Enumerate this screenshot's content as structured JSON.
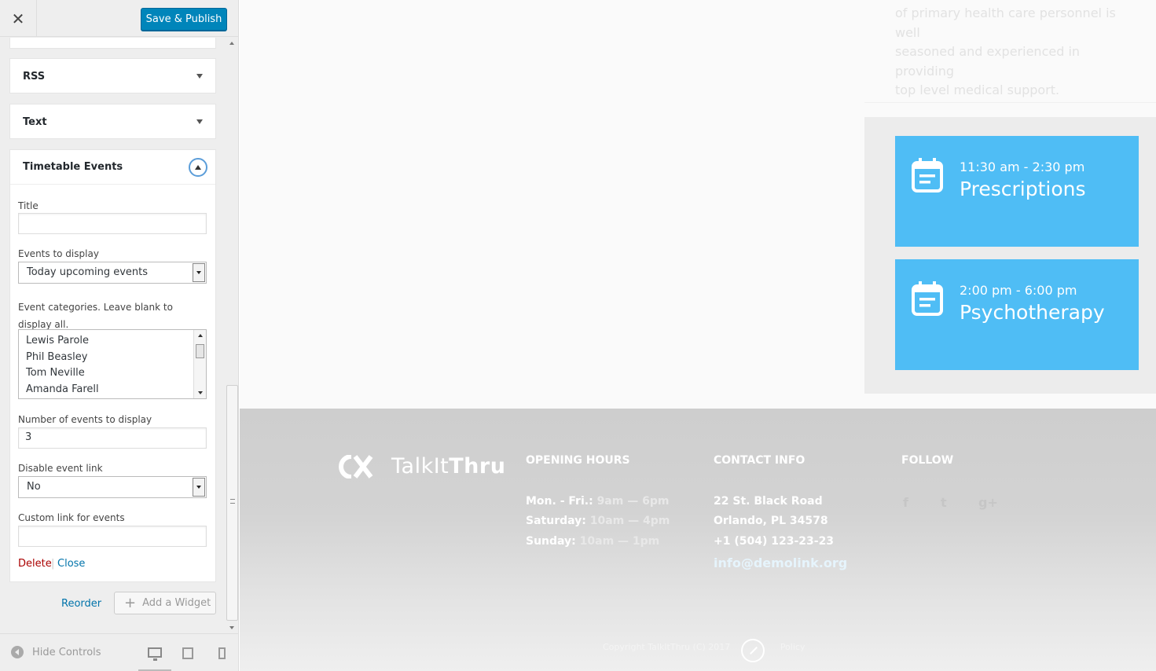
{
  "toolbar": {
    "close_symbol": "✕",
    "publish_label": "Save & Publish"
  },
  "widgets": {
    "collapsed": [
      {
        "title": "RSS"
      },
      {
        "title": "Text"
      }
    ],
    "open": {
      "title": "Timetable Events",
      "fields": {
        "title_label": "Title",
        "title_value": "",
        "events_label": "Events to display",
        "events_value": "Today upcoming events",
        "categories_label": "Event categories. Leave blank to display all.",
        "categories": [
          "Lewis Parole",
          "Phil Beasley",
          "Tom Neville",
          "Amanda Farell"
        ],
        "number_label": "Number of events to display",
        "number_value": "3",
        "disable_label": "Disable event link",
        "disable_value": "No",
        "custom_label": "Custom link for events",
        "custom_value": ""
      },
      "delete_label": "Delete",
      "separator": "|",
      "close_label": "Close"
    }
  },
  "actions": {
    "reorder_label": "Reorder",
    "add_widget_label": "Add a Widget"
  },
  "footer_controls": {
    "hide_label": "Hide Controls",
    "devices": [
      "desktop-icon",
      "tablet-icon",
      "mobile-icon"
    ]
  },
  "preview": {
    "about_lines": [
      "of primary health care personnel is well",
      "seasoned and experienced in providing",
      "top level medical support."
    ],
    "events": [
      {
        "time": "11:30 am - 2:30 pm",
        "title": "Prescriptions",
        "icon": "calendar-icon"
      },
      {
        "time": "2:00 pm - 6:00 pm",
        "title": "Psychotherapy",
        "icon": "calendar-icon"
      }
    ],
    "footer": {
      "logo_light": "TalkIt",
      "logo_bold": "Thru",
      "hours_heading": "OPENING HOURS",
      "hours": [
        {
          "day": "Mon. - Fri.:",
          "time": "9am — 6pm"
        },
        {
          "day": "Saturday:",
          "time": "10am — 4pm"
        },
        {
          "day": "Sunday:",
          "time": "10am — 1pm"
        }
      ],
      "contact_heading": "CONTACT INFO",
      "contact": [
        "22 St. Black Road",
        "Orlando, PL 34578",
        "+1 (504) 123-23-23"
      ],
      "email": "info@demolink.org",
      "follow_heading": "FOLLOW",
      "social": [
        "f",
        "t",
        "g+"
      ],
      "copyright": "Copyright TalkItThru (C) 2017",
      "policy": "Policy"
    }
  },
  "colors": {
    "accent": "#0085ba",
    "event_card": "#4fbdf5",
    "link": "#0073aa",
    "delete": "#aa0000"
  }
}
